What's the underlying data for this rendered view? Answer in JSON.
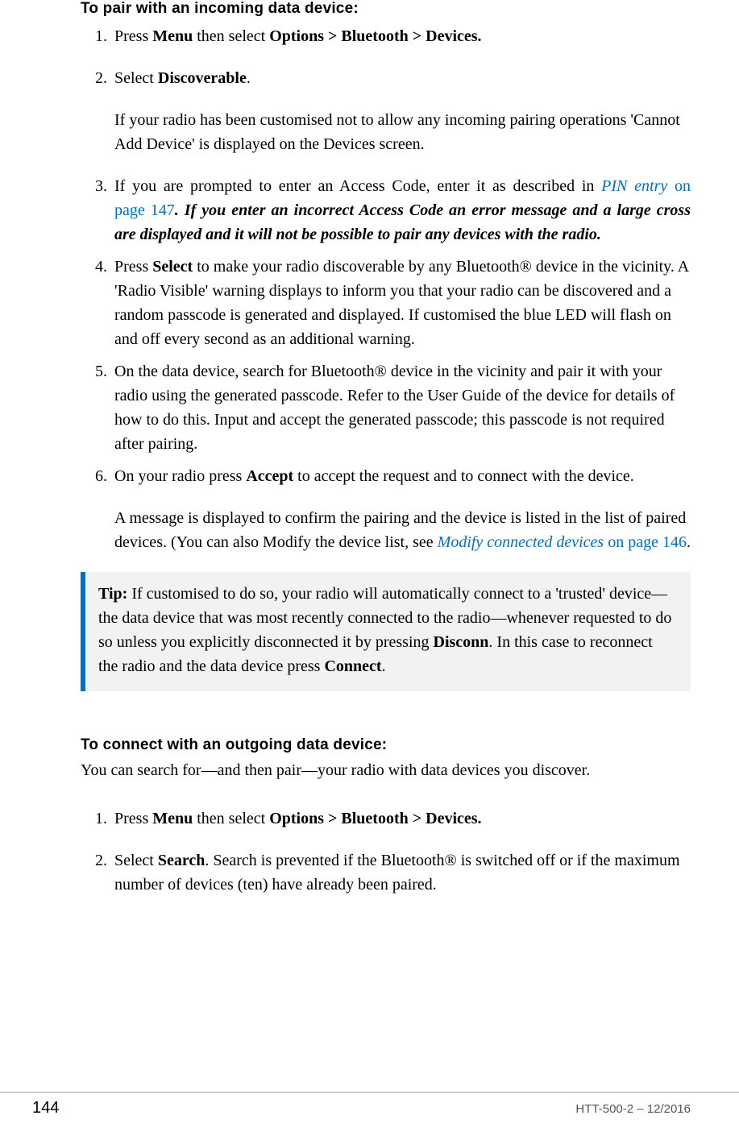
{
  "section1": {
    "heading": "To pair with an incoming data device:",
    "steps": {
      "s1": {
        "pre": "Press ",
        "menu": "Menu",
        "mid": " then select ",
        "path": "Options > Bluetooth > Devices."
      },
      "s2": {
        "pre": "Select ",
        "bold": "Discoverable",
        "post": ".",
        "para": "If your radio has been customised not to allow any incoming pairing operations 'Cannot Add Device' is displayed on the Devices screen."
      },
      "s3": {
        "pre": "If you are prompted to enter an Access Code, enter it as described in ",
        "link_text": "PIN entry",
        "link_after": " on page 147",
        "period": ".",
        "bital": " If you enter an incorrect Access Code an error message and a large cross are displayed and it will not be possible to pair any devices with the radio."
      },
      "s4": {
        "pre": "Press ",
        "bold": "Select",
        "post": " to make your radio discoverable by any Bluetooth® device in the vicinity. A 'Radio Visible' warning displays to inform you that your radio can be discovered and a random passcode is generated and displayed. If customised the blue LED will flash on and off every second as an additional warning."
      },
      "s5": {
        "text": "On the data device, search for Bluetooth® device in the vicinity and pair it with your radio using the generated passcode. Refer to the User Guide of the device for details of how to do this. Input and accept the generated passcode; this passcode is not required after pairing."
      },
      "s6": {
        "pre": "On your radio press ",
        "bold": "Accept",
        "post": " to accept the request and to connect with the device.",
        "para_pre": "A message is displayed to confirm the pairing and the device is listed in the list of paired devices. (You can also Modify the device list, see ",
        "link_text": "Modify connected devices",
        "link_after": " on page 146",
        "para_post": "."
      }
    },
    "tip": {
      "label": "Tip:",
      "pre": "  If customised to do so, your radio will automatically connect to a 'trusted' device—the data device that was most recently connected to the radio—whenever requested to do so unless you explicitly disconnected it by pressing ",
      "b1": "Disconn",
      "mid": ". In this case to reconnect the radio and the data device press ",
      "b2": "Connect",
      "post": "."
    }
  },
  "section2": {
    "heading": "To connect with an outgoing data device:",
    "intro": "You can search for—and then pair—your radio with data devices you discover.",
    "steps": {
      "s1": {
        "pre": "Press ",
        "menu": "Menu",
        "mid": " then select ",
        "path": "Options > Bluetooth > Devices."
      },
      "s2": {
        "pre": "Select ",
        "bold": "Search",
        "post": ". Search is prevented if the Bluetooth® is switched off or if the maximum number of devices (ten) have already been paired."
      }
    }
  },
  "footer": {
    "page_number": "144",
    "doc_id": "HTT-500-2 – 12/2016"
  }
}
